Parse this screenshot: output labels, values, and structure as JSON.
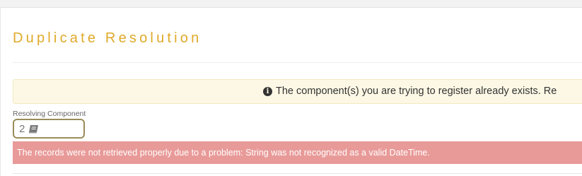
{
  "page": {
    "title": "Duplicate Resolution"
  },
  "info_banner": {
    "icon": "info-circle-icon",
    "message": "The component(s) you are trying to register already exists. Re"
  },
  "resolving_component": {
    "label": "Resolving Component",
    "value": "2",
    "icon": "book-icon"
  },
  "error": {
    "message": "The records were not retrieved properly due to a problem: String was not recognized as a valid DateTime."
  },
  "colors": {
    "title": "#e0a92a",
    "info_background": "#fdf8e5",
    "error_background": "#e89a98",
    "field_border": "#9a8c5a"
  }
}
